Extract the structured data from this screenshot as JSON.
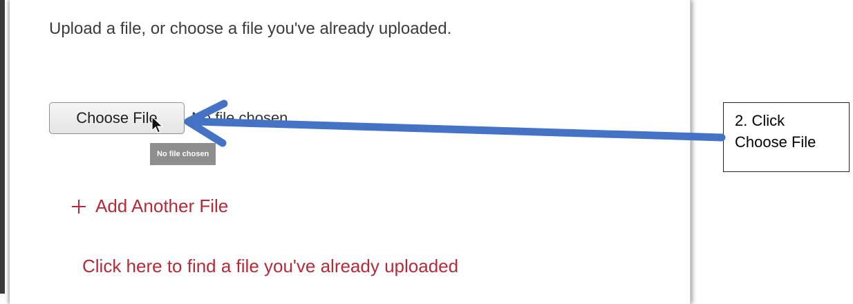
{
  "upload_panel": {
    "instructions": "Upload a file, or choose a file you've already uploaded.",
    "choose_file_label": "Choose File",
    "file_status": "No file chosen",
    "tooltip": "No file chosen",
    "add_another_label": "Add Another File",
    "find_uploaded_link": "Click here to find a file you've already uploaded"
  },
  "callout": {
    "line1": "2. Click",
    "line2": "Choose File"
  },
  "colors": {
    "link": "#b62a38",
    "arrow": "#4472c4",
    "tooltip_bg": "#8e8e8e"
  },
  "icons": [
    "plus-icon",
    "mouse-pointer-icon",
    "arrow-annotation"
  ]
}
